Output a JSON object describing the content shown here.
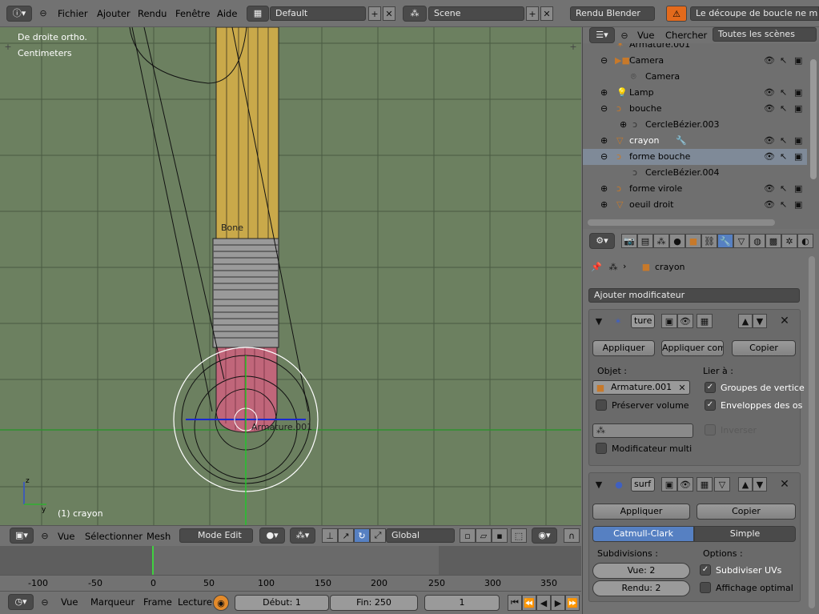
{
  "topbar": {
    "menus": [
      "Fichier",
      "Ajouter",
      "Rendu",
      "Fenêtre",
      "Aide"
    ],
    "layout": "Default",
    "scene": "Scene",
    "engine": "Rendu Blender",
    "warning": "Le découpe de boucle ne marc"
  },
  "viewport": {
    "view_label": "De droite ortho.",
    "units_label": "Centimeters",
    "bone_label": "Bone",
    "armature_label": "Armature.001",
    "object_status": "(1) crayon",
    "axis_z": "z",
    "axis_y": "y"
  },
  "view_header": {
    "vue": "Vue",
    "select": "Sélectionner",
    "mesh": "Mesh",
    "mode": "Mode Edit",
    "orientation": "Global"
  },
  "timeline": {
    "ticks": [
      "-100",
      "-50",
      "0",
      "50",
      "100",
      "150",
      "200",
      "250",
      "300",
      "350"
    ],
    "header": {
      "vue": "Vue",
      "marker": "Marqueur",
      "frame": "Frame",
      "playback": "Lecture",
      "start": "Début: 1",
      "end": "Fin: 250",
      "current": "1"
    }
  },
  "outliner": {
    "header": {
      "vue": "Vue",
      "search": "Chercher",
      "scope": "Toutes les scènes"
    },
    "items": [
      {
        "label": "Armature.001"
      },
      {
        "label": "Camera"
      },
      {
        "label": "Camera"
      },
      {
        "label": "Lamp"
      },
      {
        "label": "bouche"
      },
      {
        "label": "CercleBézier.003"
      },
      {
        "label": "crayon"
      },
      {
        "label": "forme bouche"
      },
      {
        "label": "CercleBézier.004"
      },
      {
        "label": "forme virole"
      },
      {
        "label": "oeuil droit"
      }
    ]
  },
  "properties": {
    "object_name": "crayon",
    "add_modifier": "Ajouter modificateur",
    "armature_mod": {
      "name": "ture",
      "apply": "Appliquer",
      "apply_as": "Appliquer com",
      "copy": "Copier",
      "object_label": "Objet :",
      "bind_label": "Lier à :",
      "object_value": "Armature.001",
      "vertex_groups": "Groupes de vertice",
      "preserve_volume": "Préserver volume",
      "bone_envelopes": "Enveloppes des os",
      "invert": "Inverser",
      "multi_modifier": "Modificateur multi"
    },
    "subsurf_mod": {
      "name": "surf",
      "apply": "Appliquer",
      "copy": "Copier",
      "catmull": "Catmull-Clark",
      "simple": "Simple",
      "subdiv_label": "Subdivisions :",
      "options_label": "Options :",
      "view_levels": "Vue: 2",
      "render_levels": "Rendu: 2",
      "subdivide_uvs": "Subdiviser UVs",
      "optimal_display": "Affichage optimal"
    }
  },
  "colors": {
    "viewport_bg": "#6c8060",
    "selected_tab": "#5680c2",
    "pencil_yellow": "#c9a94a",
    "eraser_pink": "#c0667a"
  }
}
